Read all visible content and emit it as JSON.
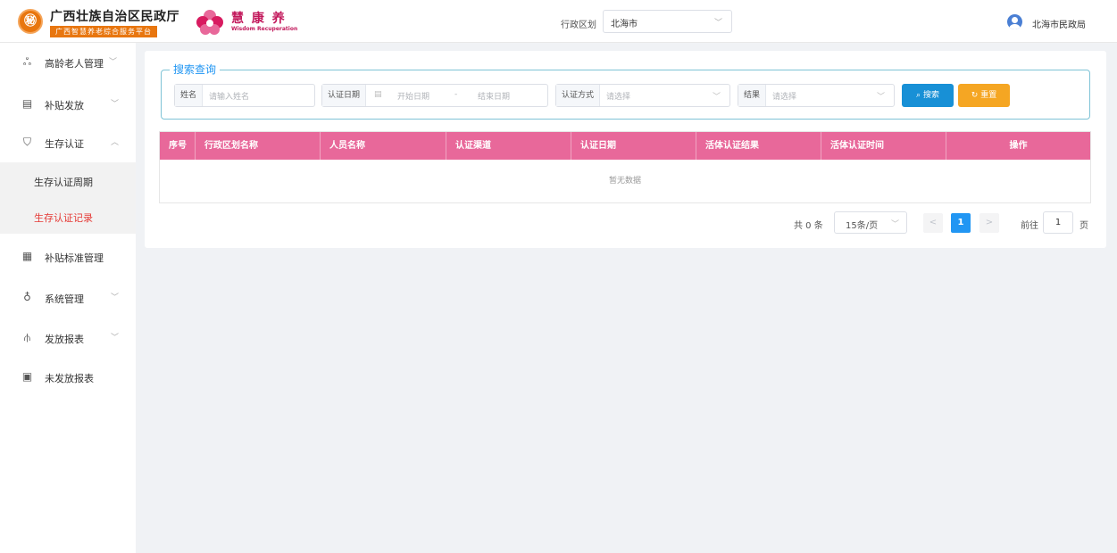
{
  "header": {
    "org_logo_char": "㊙",
    "org_name": "广西壮族自治区民政厅",
    "org_subtitle": "广西智慧养老综合服务平台",
    "brand_name": "慧 康 养",
    "brand_en": "Wisdom Recuperation",
    "region_label": "行政区划",
    "region_value": "北海市",
    "user_name": "北海市民政局"
  },
  "sidebar": {
    "items": [
      {
        "label": "高龄老人管理",
        "icon": "elderly-icon"
      },
      {
        "label": "补贴发放",
        "icon": "subsidy-icon"
      },
      {
        "label": "生存认证",
        "icon": "auth-shield-icon"
      },
      {
        "label": "补贴标准管理",
        "icon": "standard-doc-icon"
      },
      {
        "label": "系统管理",
        "icon": "system-users-icon"
      },
      {
        "label": "发放报表",
        "icon": "report-icon"
      },
      {
        "label": "未发放报表",
        "icon": "unissued-report-icon"
      }
    ],
    "sub_items": [
      {
        "label": "生存认证周期",
        "active": false
      },
      {
        "label": "生存认证记录",
        "active": true
      }
    ]
  },
  "search": {
    "legend": "搜索查询",
    "name_label": "姓名",
    "name_placeholder": "请输入姓名",
    "date_label": "认证日期",
    "date_start_placeholder": "开始日期",
    "date_sep": "-",
    "date_end_placeholder": "结束日期",
    "method_label": "认证方式",
    "method_placeholder": "请选择",
    "result_label": "结果",
    "result_placeholder": "请选择",
    "search_button": "搜索",
    "reset_button": "重置"
  },
  "table": {
    "columns": [
      "序号",
      "行政区划名称",
      "人员名称",
      "认证渠道",
      "认证日期",
      "活体认证结果",
      "活体认证时间",
      "操作"
    ],
    "empty_text": "暂无数据"
  },
  "pagination": {
    "total": "共 0 条",
    "page_size": "15条/页",
    "prev": "<",
    "current": "1",
    "next": ">",
    "goto_label": "前往",
    "goto_value": "1",
    "page_label": "页"
  },
  "colors": {
    "accent": "#2196f3",
    "table_header": "#e8689a",
    "active_menu": "#e53935",
    "search_btn": "#1890d6",
    "reset_btn": "#f5a623",
    "brand": "#e8760f"
  }
}
